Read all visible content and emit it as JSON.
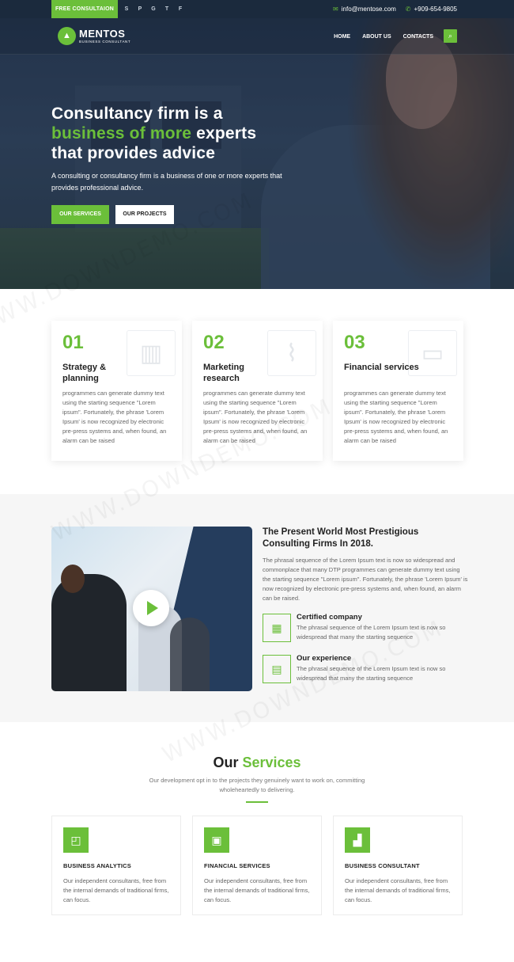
{
  "topbar": {
    "consult_label": "FREE CONSULTAION",
    "social": [
      "S",
      "P",
      "G",
      "T",
      "F"
    ],
    "email": "info@mentose.com",
    "phone": "+909-654-9805",
    "email_icon": "envelope-icon",
    "phone_icon": "phone-icon"
  },
  "nav": {
    "logo_icon": "chart-icon",
    "logo_name": "MENTOS",
    "logo_sub": "BUSINESS CONSULTANT",
    "menu": [
      "HOME",
      "ABOUT US",
      "CONTACTS"
    ],
    "search_icon": "search-icon"
  },
  "hero": {
    "title_line1": "Consultancy firm is a",
    "title_green": "business of more",
    "title_rest": " experts",
    "title_line3": "that provides advice",
    "subtitle": "A consulting or consultancy firm is a business of one or more experts that provides professional advice.",
    "btn_services": "OUR SERVICES",
    "btn_projects": "OUR PROJECTS"
  },
  "features": [
    {
      "num": "01",
      "title": "Strategy & planning",
      "text": "programmes can generate dummy text using the starting sequence \"Lorem ipsum\". Fortunately, the phrase 'Lorem Ipsum' is now recognized by electronic pre-press systems and, when found, an alarm can be raised",
      "icon": "bar-chart-icon"
    },
    {
      "num": "02",
      "title": "Marketing research",
      "text": "programmes can generate dummy text using the starting sequence \"Lorem ipsum\". Fortunately, the phrase 'Lorem Ipsum' is now recognized by electronic pre-press systems and, when found, an alarm can be raised",
      "icon": "line-chart-icon"
    },
    {
      "num": "03",
      "title": "Financial services",
      "text": "programmes can generate dummy text using the starting sequence \"Lorem ipsum\". Fortunately, the phrase 'Lorem Ipsum' is now recognized by electronic pre-press systems and, when found, an alarm can be raised",
      "icon": "money-icon"
    }
  ],
  "about": {
    "title": "The Present World Most Prestigious Consulting Firms In 2018.",
    "text": "The phrasal sequence of the Lorem Ipsum text is now so widespread and commonplace that many DTP programmes can generate dummy text using the starting sequence \"Lorem ipsum\". Fortunately, the phrase 'Lorem Ipsum' is now recognized by electronic pre-press systems and, when found, an alarm can be raised.",
    "items": [
      {
        "title": "Certified company",
        "text": "The phrasal sequence of the Lorem Ipsum text is now so widespread that many the starting sequence",
        "icon": "certificate-icon"
      },
      {
        "title": "Our experience",
        "text": "The phrasal sequence of the Lorem Ipsum text is now so widespread that many the starting sequence",
        "icon": "newspaper-icon"
      }
    ],
    "play_icon": "play-icon"
  },
  "services": {
    "heading_a": "Our ",
    "heading_b": "Services",
    "subtitle": "Our development opt in to the projects they genuinely want to work on, committing wholeheartedly to delivering.",
    "cards": [
      {
        "title": "BUSINESS ANALYTICS",
        "text": "Our independent consultants, free from the internal demands of traditional firms, can focus.",
        "icon": "presentation-icon"
      },
      {
        "title": "FINANCIAL SERVICES",
        "text": "Our independent consultants, free from the internal demands of traditional firms, can focus.",
        "icon": "cash-icon"
      },
      {
        "title": "BUSINESS CONSULTANT",
        "text": "Our independent consultants, free from the internal demands of traditional firms, can focus.",
        "icon": "growth-chart-icon"
      }
    ]
  },
  "watermark": "WWW.DOWNDEMO.COM",
  "colors": {
    "accent": "#6bbf3a",
    "dark": "#1b2a3d"
  }
}
